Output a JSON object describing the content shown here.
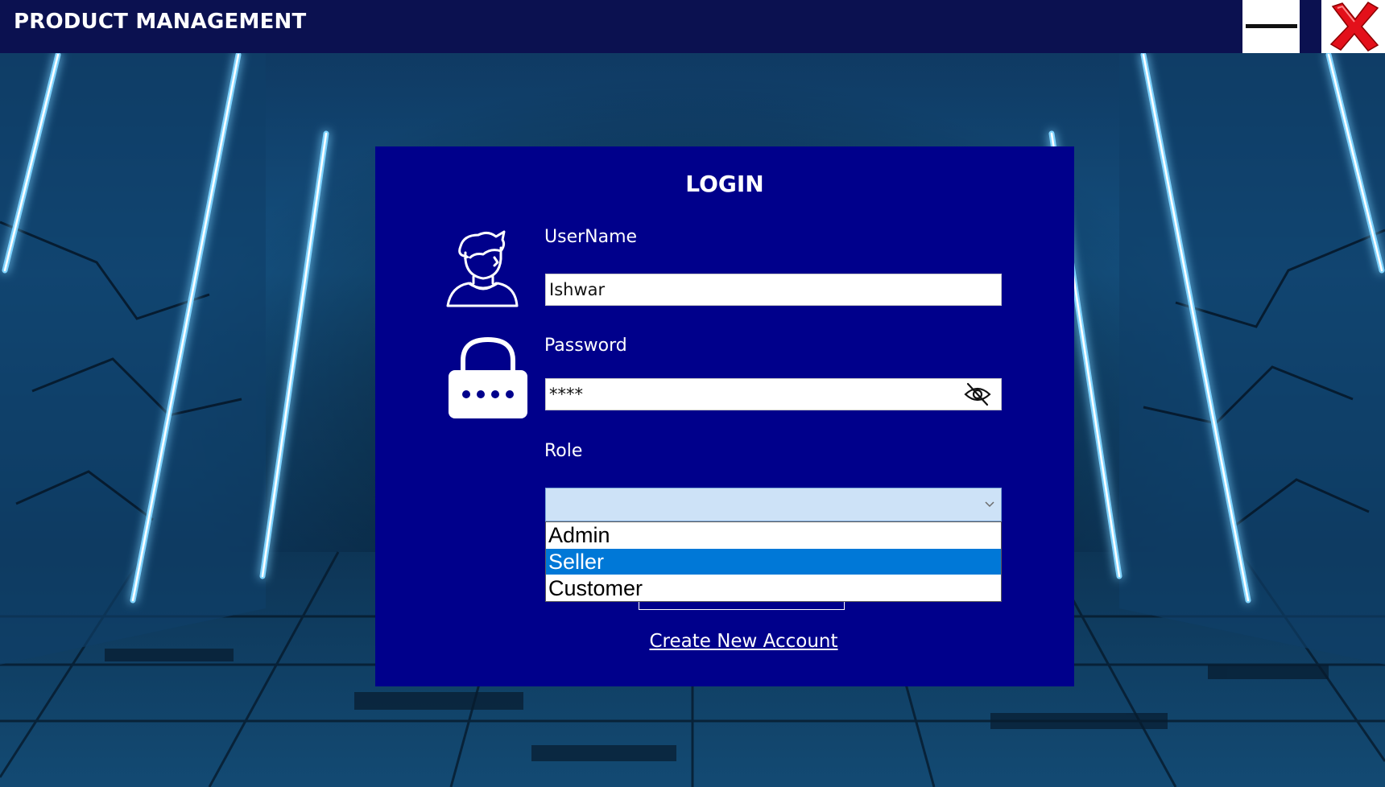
{
  "window": {
    "title": "PRODUCT MANAGEMENT",
    "minimize_icon": "minimize-icon",
    "close_icon": "close-icon",
    "close_color": "#e3101a"
  },
  "login": {
    "heading": "LOGIN",
    "username": {
      "label": "UserName",
      "value": "Ishwar",
      "icon": "user-avatar-icon"
    },
    "password": {
      "label": "Password",
      "value": "****",
      "icon": "lock-icon",
      "toggle_icon": "eye-slash-icon"
    },
    "role": {
      "label": "Role",
      "selected_value": "",
      "options": [
        "Admin",
        "Seller",
        "Customer"
      ],
      "highlighted_option": "Seller"
    },
    "create_account_link": "Create New Account"
  },
  "colors": {
    "titlebar": "#0b1150",
    "panel": "#00008b",
    "highlight": "#0078d7",
    "dropdown_field": "#cde2f7"
  }
}
